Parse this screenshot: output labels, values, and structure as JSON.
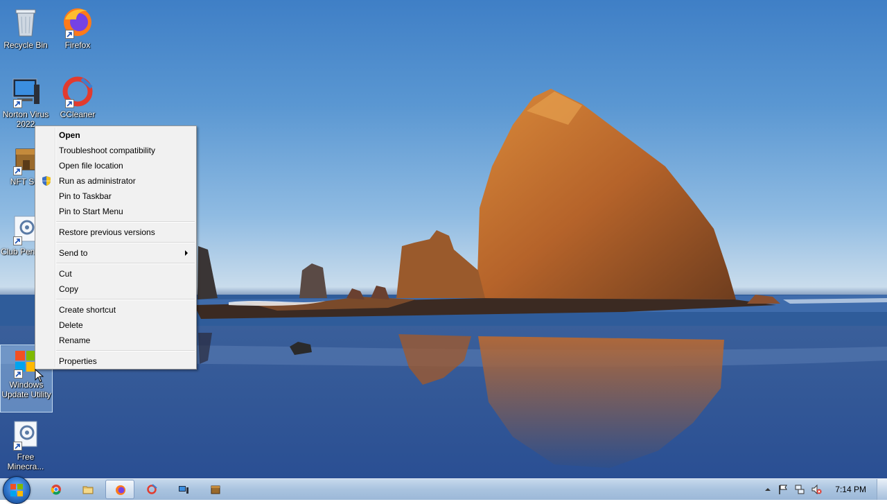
{
  "desktop": {
    "icons": [
      {
        "label": "Recycle Bin",
        "icon": "recycle-bin-icon"
      },
      {
        "label": "Firefox",
        "icon": "firefox-icon"
      },
      {
        "label": "Norton Virus 2022",
        "icon": "norton-icon"
      },
      {
        "label": "CCleaner",
        "icon": "ccleaner-icon"
      },
      {
        "label": "NFT Ste",
        "icon": "nft-store-icon"
      },
      {
        "label": "Club Penguin",
        "icon": "club-penguin-icon"
      },
      {
        "label": "Windows Update Utility",
        "icon": "windows-update-icon"
      },
      {
        "label": "Free Minecra...",
        "icon": "minecraft-icon"
      }
    ]
  },
  "context_menu": {
    "items": {
      "open": "Open",
      "troubleshoot": "Troubleshoot compatibility",
      "open_location": "Open file location",
      "run_admin": "Run as administrator",
      "pin_taskbar": "Pin to Taskbar",
      "pin_start": "Pin to Start Menu",
      "restore": "Restore previous versions",
      "send_to": "Send to",
      "cut": "Cut",
      "copy": "Copy",
      "create_shortcut": "Create shortcut",
      "delete": "Delete",
      "rename": "Rename",
      "properties": "Properties"
    }
  },
  "taskbar": {
    "apps": [
      "chrome-icon",
      "explorer-icon",
      "firefox-icon",
      "ccleaner-icon",
      "norton-icon",
      "nft-store-icon"
    ],
    "active_app": "firefox-icon",
    "clock": "7:14 PM"
  },
  "colors": {
    "menu_bg": "#f1f1f1",
    "taskbar": "#b5cce6",
    "sky": "#5a97d2"
  }
}
